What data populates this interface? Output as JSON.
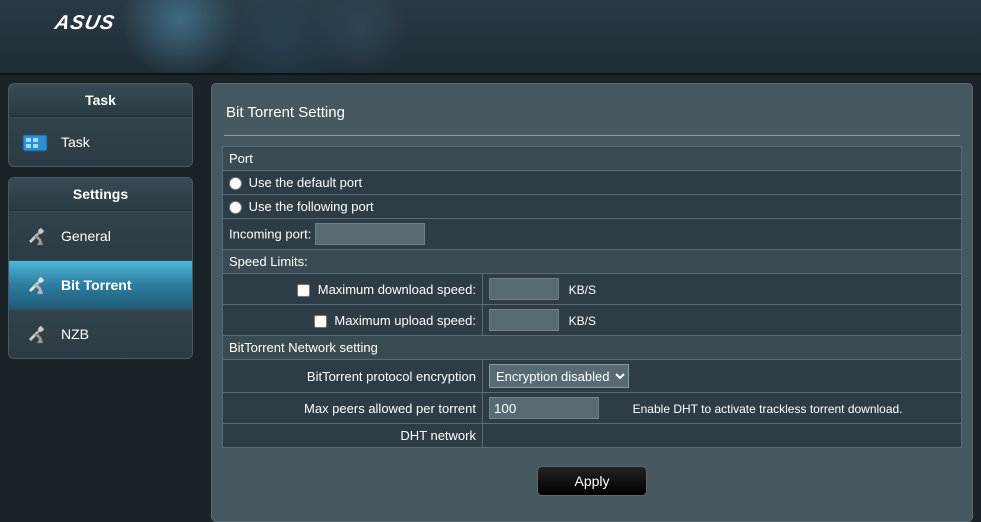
{
  "brand": "ASUS",
  "sidebar": {
    "task_header": "Task",
    "settings_header": "Settings",
    "items": {
      "task": "Task",
      "general": "General",
      "bittorrent": "Bit Torrent",
      "nzb": "NZB"
    }
  },
  "page": {
    "title": "Bit Torrent Setting",
    "port_header": "Port",
    "use_default_port": "Use the default port",
    "use_following_port": "Use the following port",
    "incoming_port_label": "Incoming port:",
    "incoming_port_value": "",
    "speed_header": "Speed Limits:",
    "max_dl_label": "Maximum download speed:",
    "max_dl_value": "",
    "max_ul_label": "Maximum upload speed:",
    "max_ul_value": "",
    "unit": "KB/S",
    "network_header": "BitTorrent Network setting",
    "encryption_label": "BitTorrent protocol encryption",
    "encryption_value": "Encryption disabled",
    "max_peers_label": "Max peers allowed per torrent",
    "max_peers_value": "100",
    "dht_label": "DHT network",
    "dht_hint": "Enable DHT to activate trackless torrent download.",
    "apply": "Apply"
  }
}
